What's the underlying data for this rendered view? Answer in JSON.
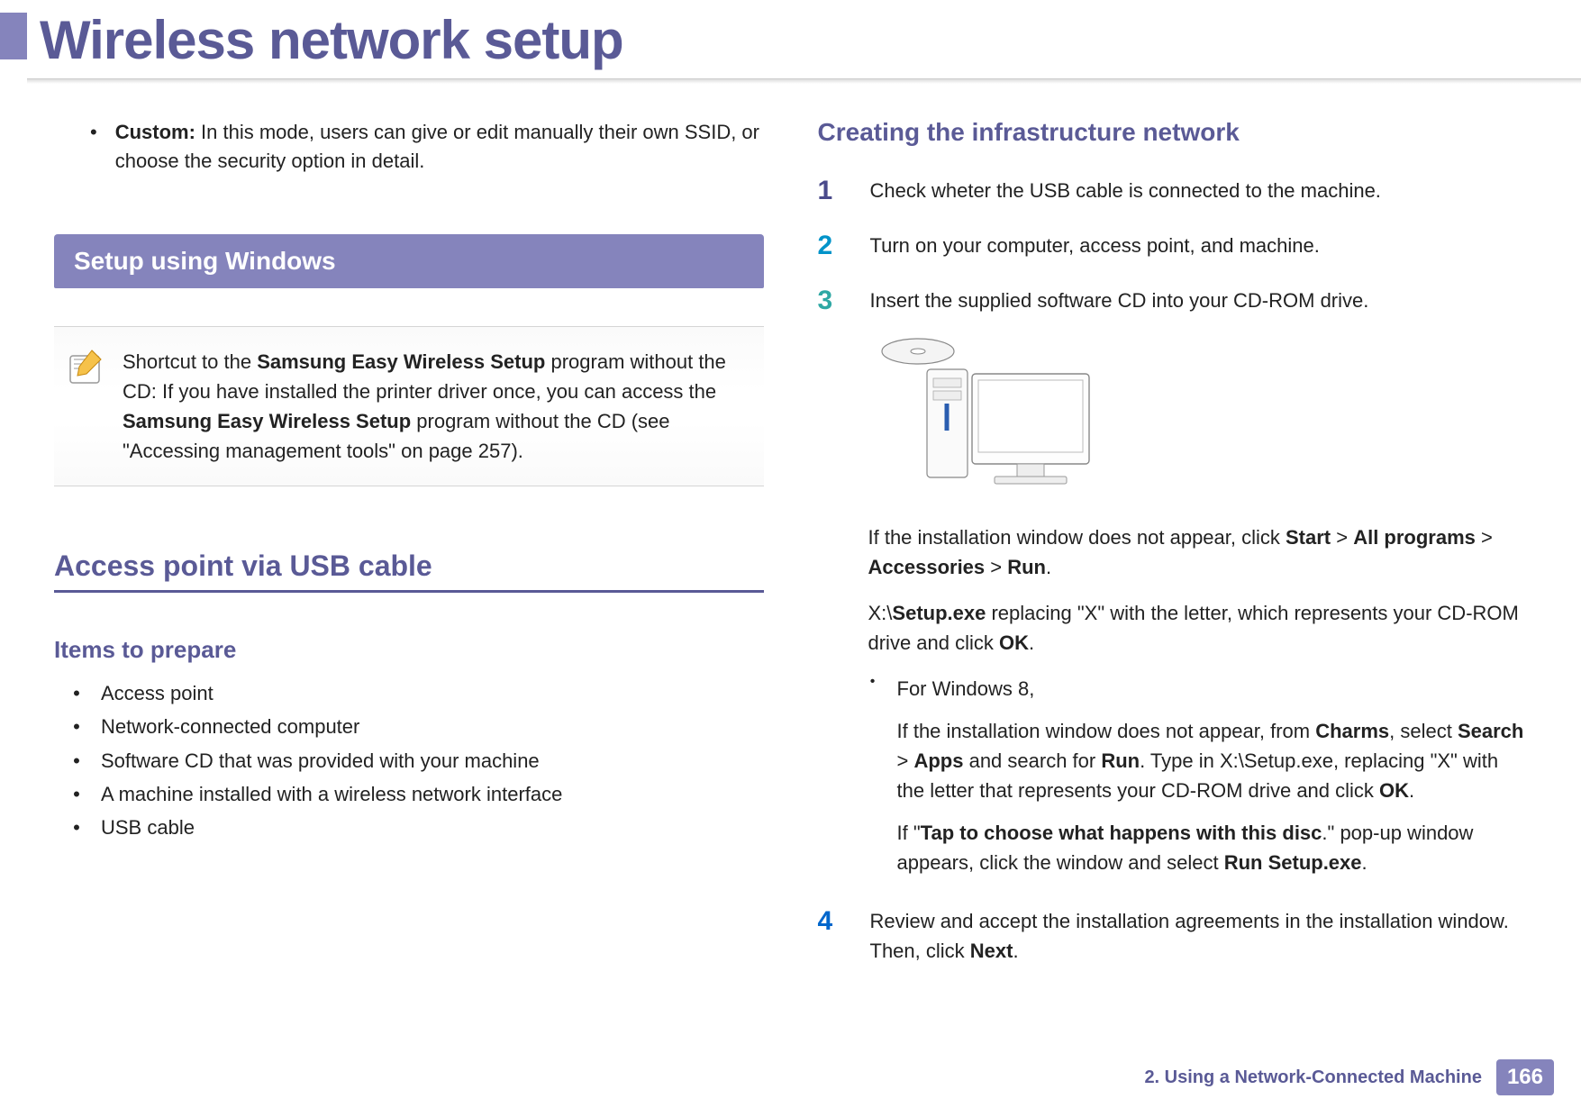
{
  "page": {
    "title": "Wireless network setup",
    "footer_chapter": "2.  Using a Network-Connected Machine",
    "page_number": "166"
  },
  "left": {
    "custom_bullet_strong": "Custom:",
    "custom_bullet_rest": " In this mode, users can give or edit manually their own SSID, or choose the security option in detail.",
    "section_heading": "Setup using Windows",
    "note_pre": "Shortcut to the ",
    "note_b1": "Samsung Easy Wireless Setup",
    "note_mid1": " program without the CD: If you have installed the printer driver once, you can access the ",
    "note_b2": "Samsung Easy Wireless Setup",
    "note_mid2": " program without the CD (see \"Accessing management tools\" on page 257).",
    "usb_heading": "Access point via USB cable",
    "items_heading": "Items to prepare",
    "items": [
      "Access point",
      "Network-connected computer",
      "Software CD that was provided with your machine",
      "A machine installed with a wireless network interface",
      "USB cable"
    ]
  },
  "right": {
    "heading": "Creating the infrastructure network",
    "step1": "Check wheter the USB cable is connected to the machine.",
    "step2": "Turn on your computer, access point, and machine.",
    "step3": "Insert the supplied software CD into your CD-ROM drive.",
    "after_illus_p1_pre": "If the installation window does not appear, click ",
    "after_illus_p1_b1": "Start",
    "after_illus_p1_gt1": " > ",
    "after_illus_p1_b2": "All programs",
    "after_illus_p1_gt2": " > ",
    "after_illus_p1_b3": "Accessories",
    "after_illus_p1_gt3": " > ",
    "after_illus_p1_b4": "Run",
    "after_illus_p1_end": ".",
    "after_illus_p2_pre": " X:\\",
    "after_illus_p2_b1": "Setup.exe",
    "after_illus_p2_mid": " replacing \"X\" with the letter, which represents your CD-ROM drive and click ",
    "after_illus_p2_b2": "OK",
    "after_illus_p2_end": ".",
    "win8_label": "For Windows 8,",
    "win8_p1_pre": "If the installation window does not appear, from ",
    "win8_p1_b1": "Charms",
    "win8_p1_mid1": ", select ",
    "win8_p1_b2": "Search",
    "win8_p1_gt": " > ",
    "win8_p1_b3": "Apps",
    "win8_p1_mid2": " and search for ",
    "win8_p1_b4": "Run",
    "win8_p1_mid3": ". Type in X:\\Setup.exe, replacing \"X\" with the letter that represents your CD-ROM drive and click ",
    "win8_p1_b5": "OK",
    "win8_p1_end": ".",
    "win8_p2_pre": "If \"",
    "win8_p2_b1": "Tap to choose what happens with this disc",
    "win8_p2_mid": ".\" pop-up window appears, click the window and select ",
    "win8_p2_b2": "Run Setup.exe",
    "win8_p2_end": ".",
    "step4_pre": "Review and accept the installation agreements in the installation window. Then, click ",
    "step4_b": "Next",
    "step4_end": "."
  },
  "numbers": {
    "n1": "1",
    "n2": "2",
    "n3": "3",
    "n4": "4"
  },
  "bullet": "•"
}
